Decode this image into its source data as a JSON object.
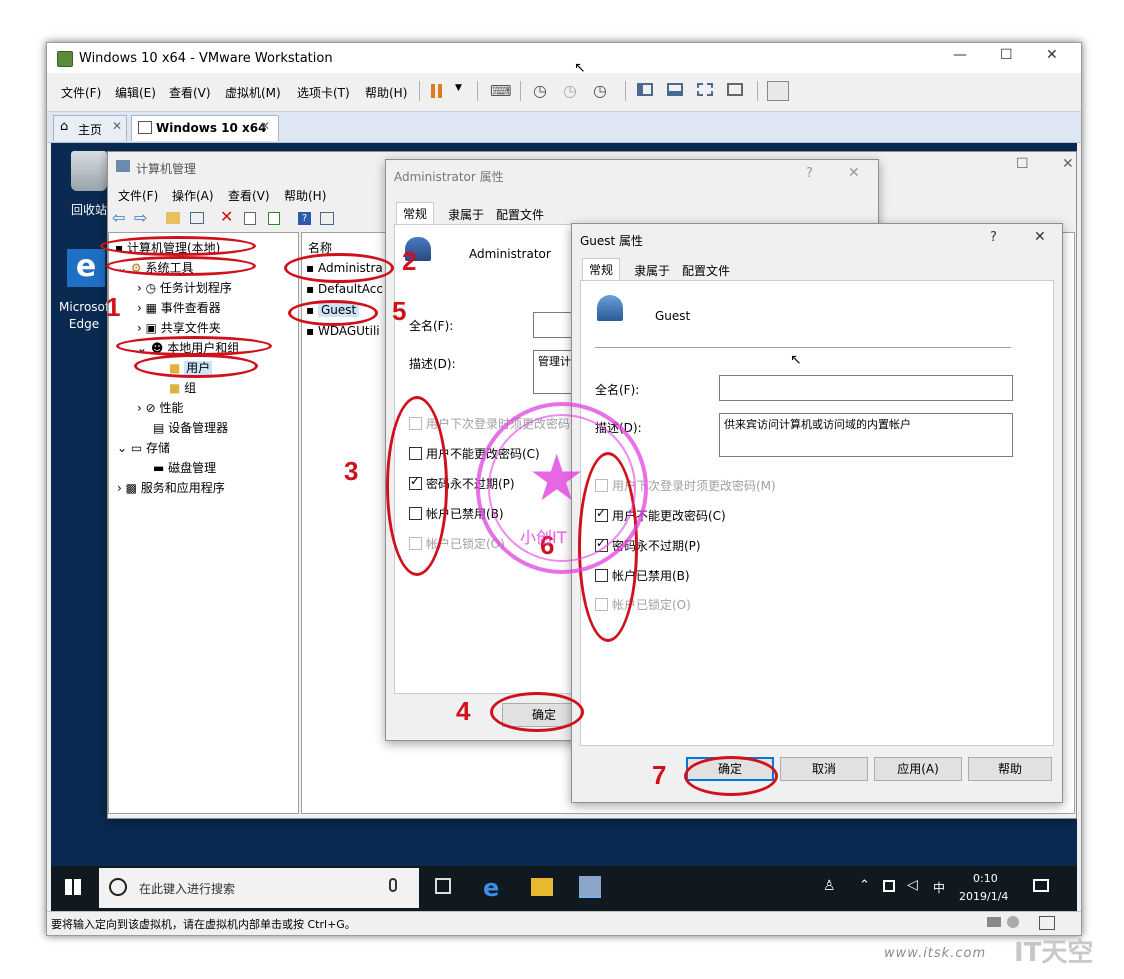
{
  "vmware": {
    "title": "Windows 10 x64 - VMware Workstation",
    "menu": [
      "文件(F)",
      "编辑(E)",
      "查看(V)",
      "虚拟机(M)",
      "选项卡(T)",
      "帮助(H)"
    ],
    "tabs": [
      {
        "label": "主页"
      },
      {
        "label": "Windows 10 x64"
      }
    ],
    "status": "要将输入定向到该虚拟机，请在虚拟机内部单击或按 Ctrl+G。"
  },
  "desktop": {
    "recycle_bin": "回收站",
    "edge": "Microsoft Edge"
  },
  "compmgmt": {
    "title": "计算机管理",
    "menu": [
      "文件(F)",
      "操作(A)",
      "查看(V)",
      "帮助(H)"
    ],
    "tree": [
      "计算机管理(本地)",
      "系统工具",
      "任务计划程序",
      "事件查看器",
      "共享文件夹",
      "本地用户和组",
      "用户",
      "组",
      "性能",
      "设备管理器",
      "存储",
      "磁盘管理",
      "服务和应用程序"
    ],
    "list_header": "名称",
    "list": [
      "Administra",
      "DefaultAcc",
      "Guest",
      "WDAGUtili"
    ]
  },
  "admin_dialog": {
    "title": "Administrator 属性",
    "tabs": [
      "常规",
      "隶属于",
      "配置文件"
    ],
    "user": "Administrator",
    "fullname_label": "全名(F):",
    "desc_label": "描述(D):",
    "desc_value": "管理计",
    "checks": [
      {
        "label": "用户下次登录时须更改密码",
        "checked": false,
        "disabled": true
      },
      {
        "label": "用户不能更改密码(C)",
        "checked": false,
        "disabled": false
      },
      {
        "label": "密码永不过期(P)",
        "checked": true,
        "disabled": false
      },
      {
        "label": "帐户已禁用(B)",
        "checked": false,
        "disabled": false
      },
      {
        "label": "帐户已锁定(O)",
        "checked": false,
        "disabled": true
      }
    ],
    "ok": "确定"
  },
  "guest_dialog": {
    "title": "Guest 属性",
    "help": "?",
    "tabs": [
      "常规",
      "隶属于",
      "配置文件"
    ],
    "user": "Guest",
    "fullname_label": "全名(F):",
    "desc_label": "描述(D):",
    "desc_value": "供来宾访问计算机或访问域的内置帐户",
    "checks": [
      {
        "label": "用户下次登录时须更改密码(M)",
        "checked": false,
        "disabled": true
      },
      {
        "label": "用户不能更改密码(C)",
        "checked": true,
        "disabled": false
      },
      {
        "label": "密码永不过期(P)",
        "checked": true,
        "disabled": false
      },
      {
        "label": "帐户已禁用(B)",
        "checked": false,
        "disabled": false
      },
      {
        "label": "帐户已锁定(O)",
        "checked": false,
        "disabled": true
      }
    ],
    "buttons": {
      "ok": "确定",
      "cancel": "取消",
      "apply": "应用(A)",
      "help": "帮助"
    }
  },
  "taskbar": {
    "search_placeholder": "在此键入进行搜索",
    "ime": "中",
    "time": "0:10",
    "date": "2019/1/4"
  },
  "annotations": [
    "1",
    "2",
    "3",
    "4",
    "5",
    "6",
    "7"
  ],
  "stamp_text": "小创IT",
  "watermark": "www.itsk.com",
  "watermark_logo": "IT天空",
  "colors": {
    "annotation": "#d0101a",
    "stamp": "#e040e0",
    "desktop": "#0a2a52"
  }
}
